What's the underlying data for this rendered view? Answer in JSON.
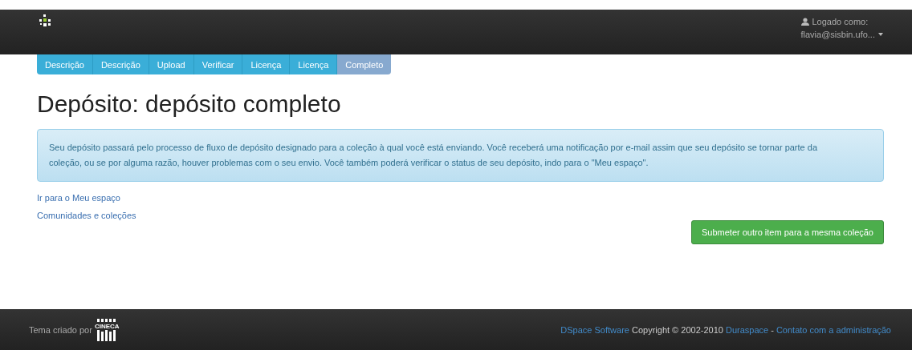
{
  "navbar": {
    "login_label": "Logado como:",
    "user": "flavia@sisbin.ufo..."
  },
  "steps": [
    {
      "label": "Descrição",
      "selected": false
    },
    {
      "label": "Descrição",
      "selected": false
    },
    {
      "label": "Upload",
      "selected": false
    },
    {
      "label": "Verificar",
      "selected": false
    },
    {
      "label": "Licença",
      "selected": false
    },
    {
      "label": "Licença",
      "selected": false
    },
    {
      "label": "Completo",
      "selected": true
    }
  ],
  "title": "Depósito: depósito completo",
  "alert": "Seu depósito passará pelo processo de fluxo de depósito designado para a coleção à qual você está enviando. Você receberá uma notificação por e-mail assim que seu depósito se tornar parte da coleção, ou se por alguma razão, houver problemas com o seu envio. Você também poderá verificar o status de seu depósito, indo para o \"Meu espaço\".",
  "links": [
    "Ir para o Meu espaço",
    "Comunidades e coleções"
  ],
  "submit_button": "Submeter outro item para a mesma coleção",
  "footer": {
    "theme_text": "Tema criado por",
    "logo_text": "CINECA",
    "dspace_link": "DSpace Software",
    "copyright": "Copyright © 2002-2010",
    "duraspace_link": "Duraspace",
    "separator": "-",
    "contact_link": "Contato com a administração"
  }
}
